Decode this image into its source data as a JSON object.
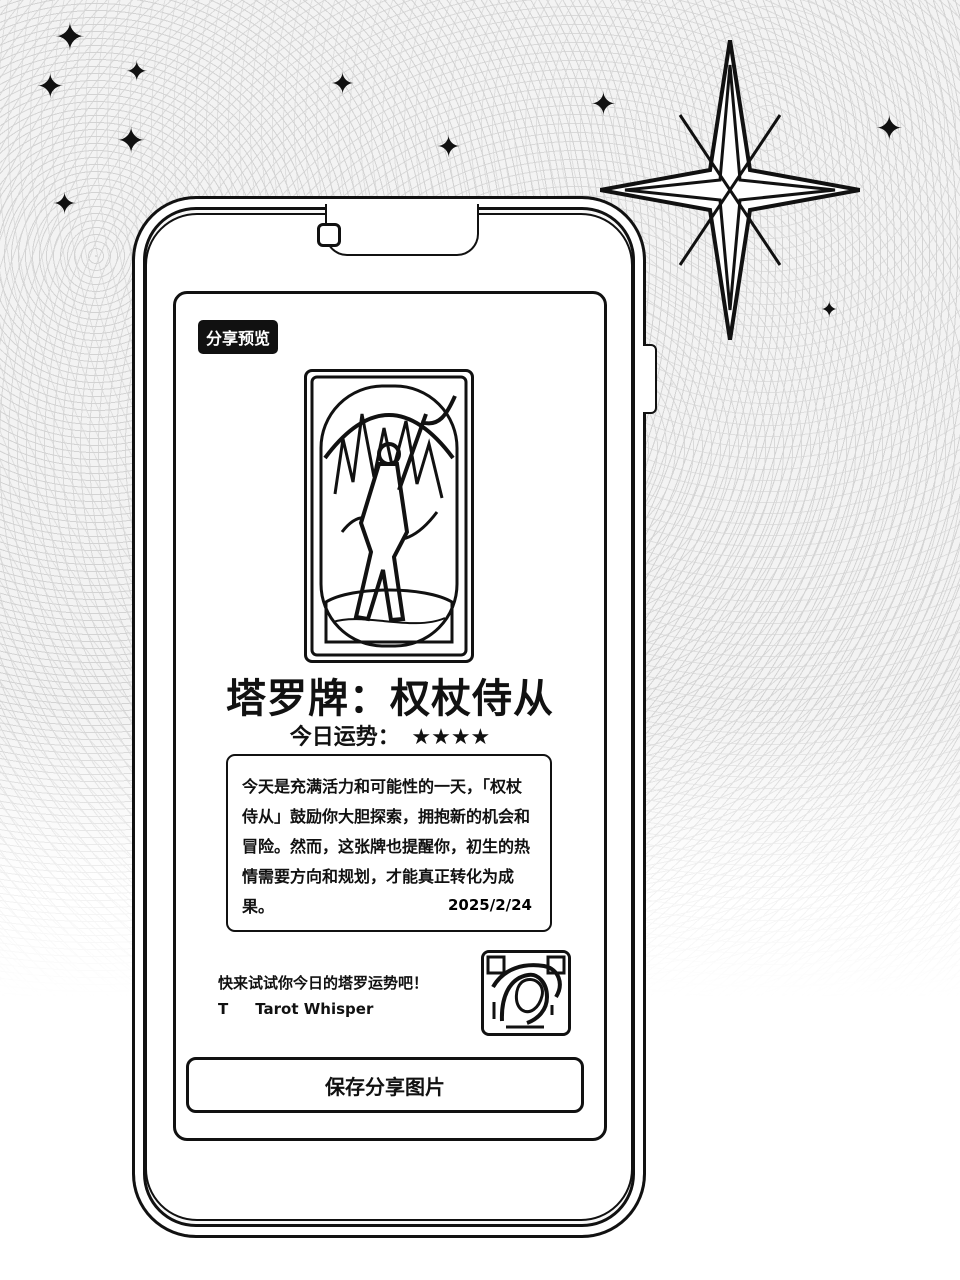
{
  "decoration": {
    "sparkle_glyph": "✦"
  },
  "screen": {
    "badge_label": "分享预览",
    "tarot_card": {
      "title": "塔罗牌：权杖侍从",
      "fortune_label": "今日运势：",
      "fortune_stars": "★★★★",
      "fortune_value": 4,
      "reading": "今天是充满活力和可能性的一天，「权杖侍从」鼓励你大胆探索，拥抱新的机会和冒险。然而，这张牌也提醒你，初生的热情需要方向和规划，才能真正转化为成果。",
      "date": "2025/2/24"
    },
    "promo_text": "快来试试你今日的塔罗运势吧！",
    "brand": {
      "icon_name": "tarot-logo-icon",
      "icon_glyph": "T",
      "name": "Tarot Whisper"
    },
    "qr_code_icon_name": "qr-code-icon",
    "save_button_label": "保存分享图片"
  }
}
